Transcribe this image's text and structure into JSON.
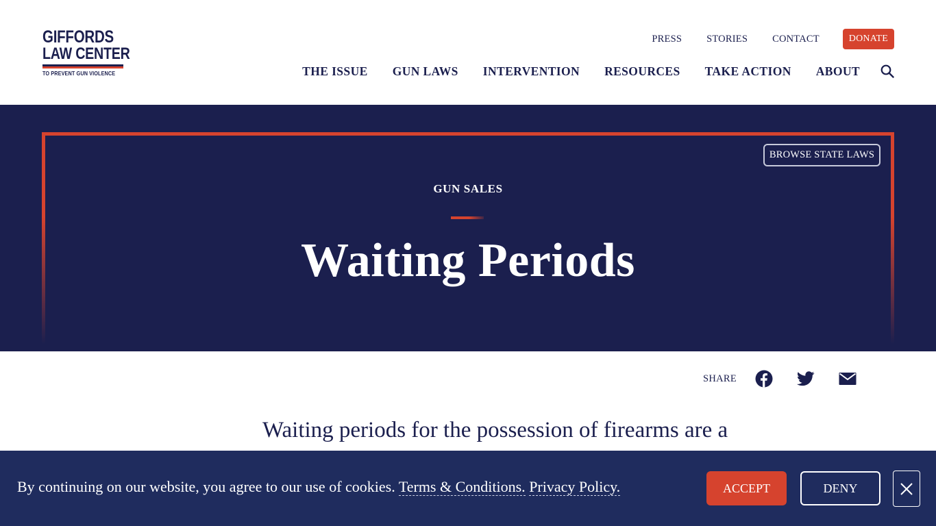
{
  "logo": {
    "line1": "GIFFORDS",
    "line2": "LAW CENTER",
    "tagline": "TO PREVENT GUN VIOLENCE"
  },
  "util_nav": {
    "items": [
      "PRESS",
      "STORIES",
      "CONTACT"
    ],
    "donate_label": "DONATE"
  },
  "main_nav": {
    "items": [
      "THE ISSUE",
      "GUN LAWS",
      "INTERVENTION",
      "RESOURCES",
      "TAKE ACTION",
      "ABOUT"
    ],
    "search_icon": "search-icon"
  },
  "hero": {
    "browse_label": "BROWSE STATE LAWS",
    "eyebrow": "GUN SALES",
    "title": "Waiting Periods"
  },
  "share": {
    "label": "SHARE",
    "icons": [
      "facebook-icon",
      "twitter-icon",
      "email-icon"
    ]
  },
  "article": {
    "lede": "Waiting periods for the possession of firearms are a"
  },
  "cookie": {
    "text": "By continuing on our website, you agree to our use of cookies.",
    "terms_link": "Terms & Conditions.",
    "privacy_link": "Privacy Policy.",
    "accept_label": "ACCEPT",
    "deny_label": "DENY"
  },
  "colors": {
    "navy": "#1b1f4e",
    "cookie_bg": "#1f2c5e",
    "accent_red": "#d6432e",
    "white": "#ffffff"
  }
}
